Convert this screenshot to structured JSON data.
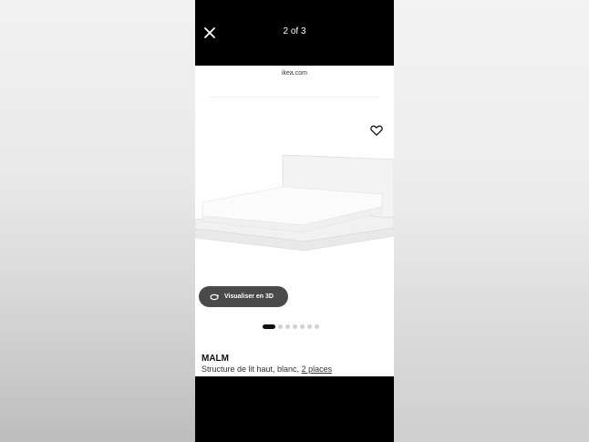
{
  "viewer": {
    "close_icon": "close-icon",
    "counter": "2 of 3"
  },
  "page": {
    "url": "ikea.com",
    "favorite_icon": "heart-outline-icon",
    "view_3d": {
      "label": "Visualiser en 3D",
      "icon": "rotate-3d-icon"
    },
    "carousel": {
      "total": 7,
      "active_index": 0
    },
    "product": {
      "name": "MALM",
      "description": "Structure de lit haut, blanc, ",
      "size_link": "2 places"
    }
  },
  "colors": {
    "viewer_bar": "#000000",
    "page_background": "#ffffff",
    "pill_background": "#4a4a4a",
    "active_dot": "#111111",
    "inactive_dot": "#d0d0d0"
  }
}
